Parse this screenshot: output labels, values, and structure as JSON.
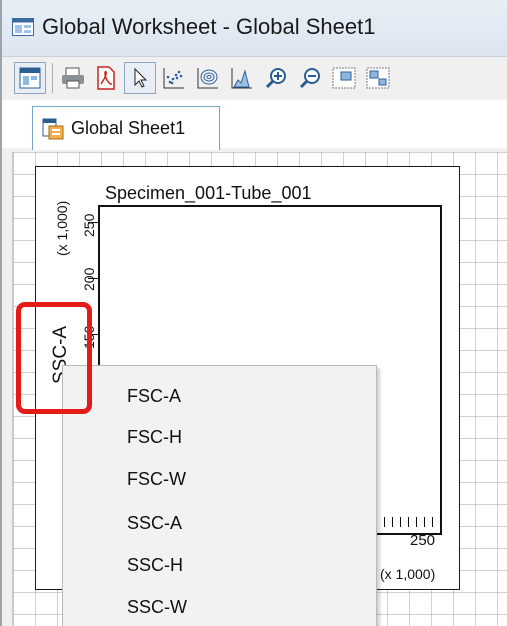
{
  "window": {
    "title": "Global Worksheet - Global Sheet1"
  },
  "toolbar": {
    "buttons": [
      "worksheet-icon",
      "print-icon",
      "pdf-icon",
      "pointer-icon",
      "dot-plot-icon",
      "contour-plot-icon",
      "histogram-icon",
      "zoom-in-icon",
      "zoom-out-icon",
      "page-view-icon",
      "page-layout-icon"
    ]
  },
  "tabs": [
    {
      "label": "Global Sheet1",
      "active": true
    }
  ],
  "plot": {
    "title": "Specimen_001-Tube_001",
    "y_axis_label": "SSC-A",
    "y_scale_label": "(x 1,000)",
    "y_ticks": [
      "250",
      "200",
      "150"
    ],
    "x_tick_label": "250",
    "x_scale_label": "(x 1,000)"
  },
  "context_menu": {
    "items": [
      "FSC-A",
      "FSC-H",
      "FSC-W",
      "SSC-A",
      "SSC-H",
      "SSC-W"
    ]
  },
  "colors": {
    "highlight": "#e41b17",
    "title_bar": "#dde6f0",
    "tab_border": "#7aa7c7"
  }
}
